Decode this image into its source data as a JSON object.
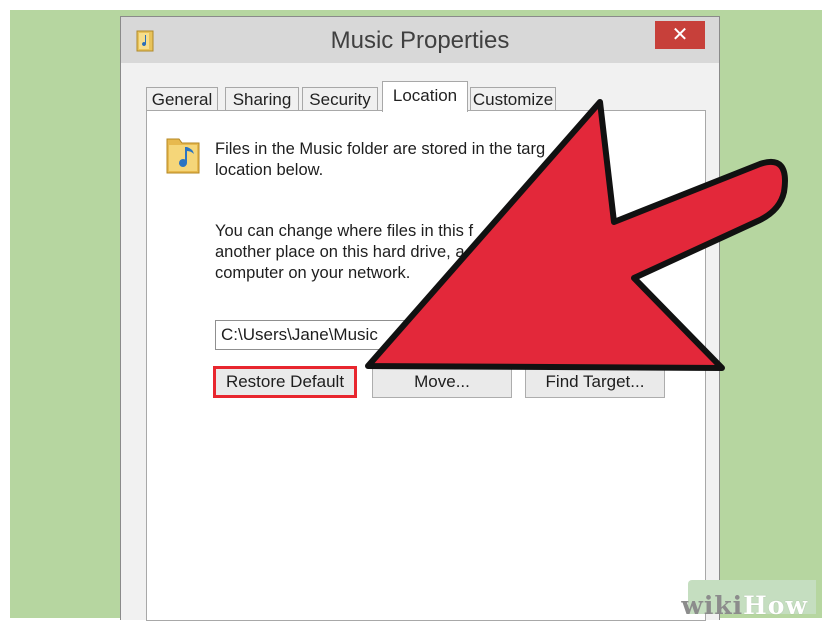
{
  "window": {
    "title": "Music Properties",
    "close_label": "✕"
  },
  "tabs": [
    {
      "label": "General"
    },
    {
      "label": "Sharing"
    },
    {
      "label": "Security"
    },
    {
      "label": "Location",
      "active": true
    },
    {
      "label": "Customize"
    }
  ],
  "panel": {
    "info_line1": "Files in the Music folder are stored in the targ",
    "info_line2": "location below.",
    "change_line1": "You can change where files in this f",
    "change_line2": "another place on this hard drive, a",
    "change_line3": "computer on your network.",
    "path_value": "C:\\Users\\Jane\\Music",
    "restore_label": "Restore Default",
    "move_label": "Move...",
    "find_label": "Find Target..."
  },
  "watermark": {
    "part1": "wiki",
    "part2": "How"
  },
  "colors": {
    "arrow": "#e3283a",
    "highlight": "#e8262e",
    "close": "#c7403a",
    "background": "#b6d6a0"
  },
  "icons": {
    "title": "folder-music-icon",
    "folder": "folder-music-icon"
  }
}
